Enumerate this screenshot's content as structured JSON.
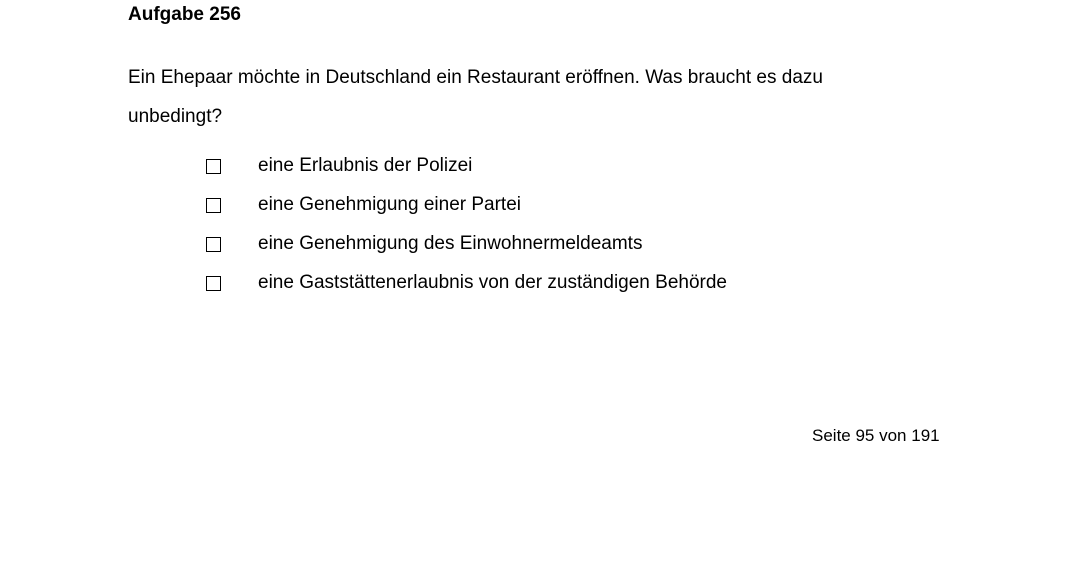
{
  "title": "Aufgabe 256",
  "question": "Ein Ehepaar möchte in Deutschland ein Restaurant eröffnen. Was braucht es dazu unbedingt?",
  "options": [
    "eine Erlaubnis der Polizei",
    "eine Genehmigung einer Partei",
    "eine Genehmigung des Einwohnermeldeamts",
    "eine Gaststättenerlaubnis von der zuständigen Behörde"
  ],
  "footer": "Seite 95 von 191"
}
